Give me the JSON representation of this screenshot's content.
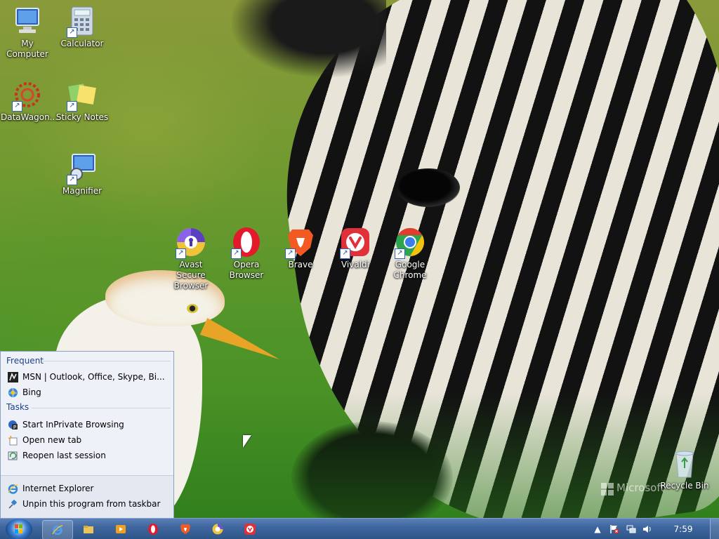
{
  "desktop": {
    "icons": [
      {
        "label": "My Computer",
        "icon": "computer-icon"
      },
      {
        "label": "Calculator",
        "icon": "calculator-icon"
      },
      {
        "label": "DataWagon...",
        "icon": "datawagon-icon"
      },
      {
        "label": "Sticky Notes",
        "icon": "sticky-notes-icon"
      },
      {
        "label": "Magnifier",
        "icon": "magnifier-icon"
      },
      {
        "label": "Avast Secure Browser",
        "icon": "avast-browser-icon"
      },
      {
        "label": "Opera Browser",
        "icon": "opera-icon"
      },
      {
        "label": "Brave",
        "icon": "brave-icon"
      },
      {
        "label": "Vivaldi",
        "icon": "vivaldi-icon"
      },
      {
        "label": "Google Chrome",
        "icon": "chrome-icon"
      },
      {
        "label": "Recycle Bin",
        "icon": "recycle-bin-icon"
      }
    ],
    "watermark": "Microsoft"
  },
  "jumplist": {
    "frequent_header": "Frequent",
    "frequent": [
      {
        "label": "MSN | Outlook, Office, Skype, Bi...",
        "icon": "msn-icon"
      },
      {
        "label": "Bing",
        "icon": "bing-icon"
      }
    ],
    "tasks_header": "Tasks",
    "tasks": [
      {
        "label": "Start InPrivate Browsing",
        "icon": "inprivate-icon"
      },
      {
        "label": "Open new tab",
        "icon": "new-tab-icon"
      },
      {
        "label": "Reopen last session",
        "icon": "reopen-session-icon"
      }
    ],
    "pinned": [
      {
        "label": "Internet Explorer",
        "icon": "internet-explorer-icon"
      },
      {
        "label": "Unpin this program from taskbar",
        "icon": "unpin-icon"
      }
    ]
  },
  "taskbar": {
    "apps": [
      "internet-explorer-icon",
      "file-explorer-icon",
      "media-player-icon",
      "opera-icon",
      "brave-icon",
      "avast-browser-icon",
      "vivaldi-icon"
    ],
    "clock": "7:59 AM"
  },
  "colors": {
    "taskbar": "#3e669e",
    "jumplist_bg": "#eef2f8",
    "header_text": "#1e3f8a"
  }
}
